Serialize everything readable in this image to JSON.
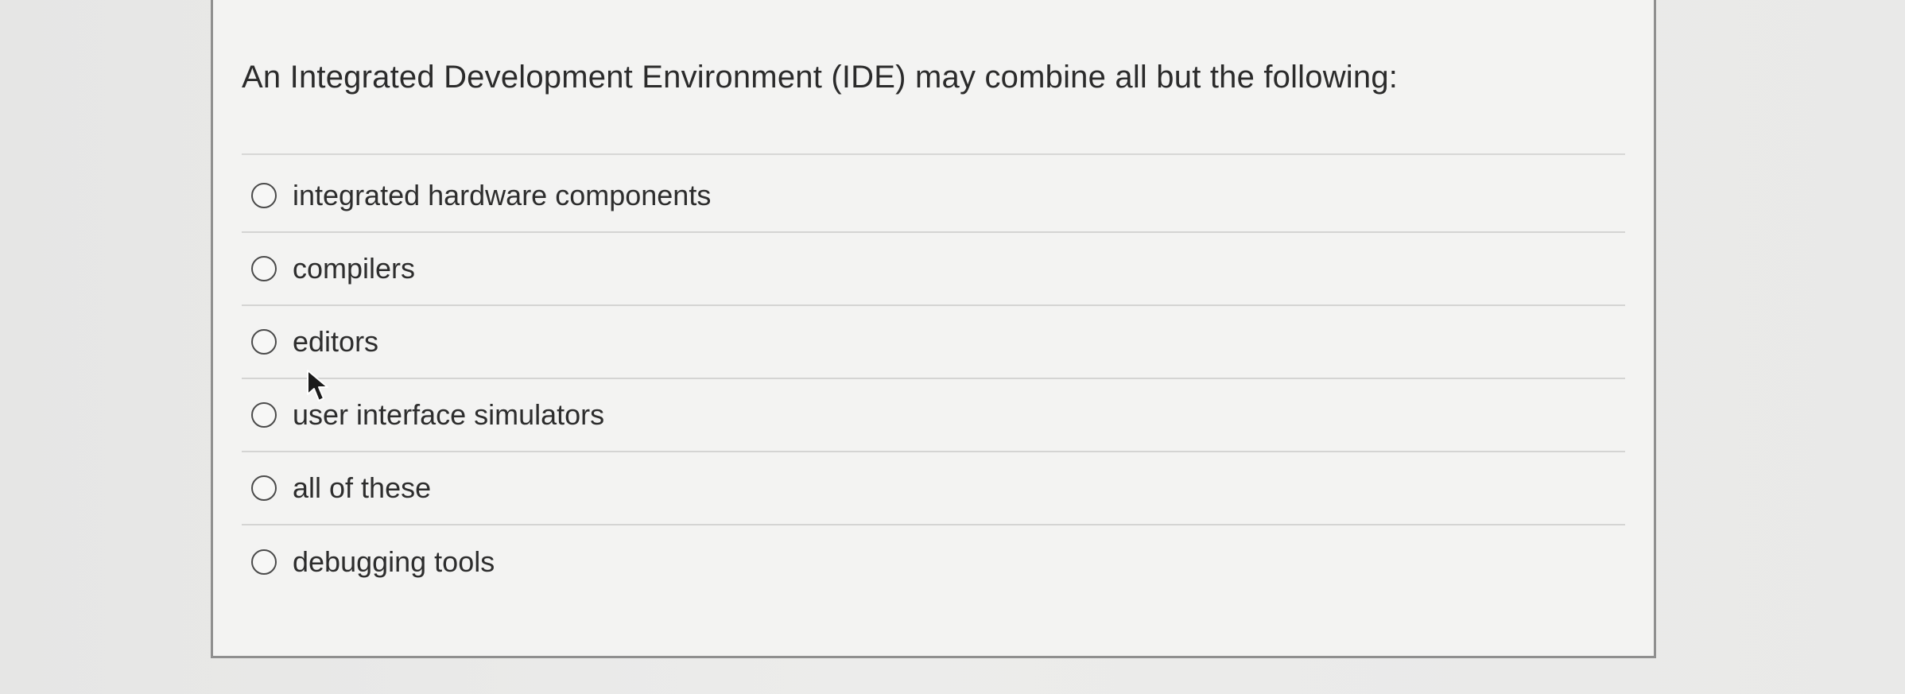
{
  "question": {
    "text": "An Integrated Development Environment (IDE) may combine all but the following:"
  },
  "answers": [
    {
      "label": "integrated hardware components"
    },
    {
      "label": "compilers"
    },
    {
      "label": "editors"
    },
    {
      "label": "user interface simulators"
    },
    {
      "label": "all of these"
    },
    {
      "label": "debugging tools"
    }
  ],
  "icons": {
    "radio": "radio-button-unselected-icon",
    "cursor": "mouse-pointer-icon"
  },
  "colors": {
    "card_border": "#8f8f8f",
    "card_background": "#f3f3f2",
    "text": "#2b2b2b",
    "divider": "#d4d4d3"
  }
}
